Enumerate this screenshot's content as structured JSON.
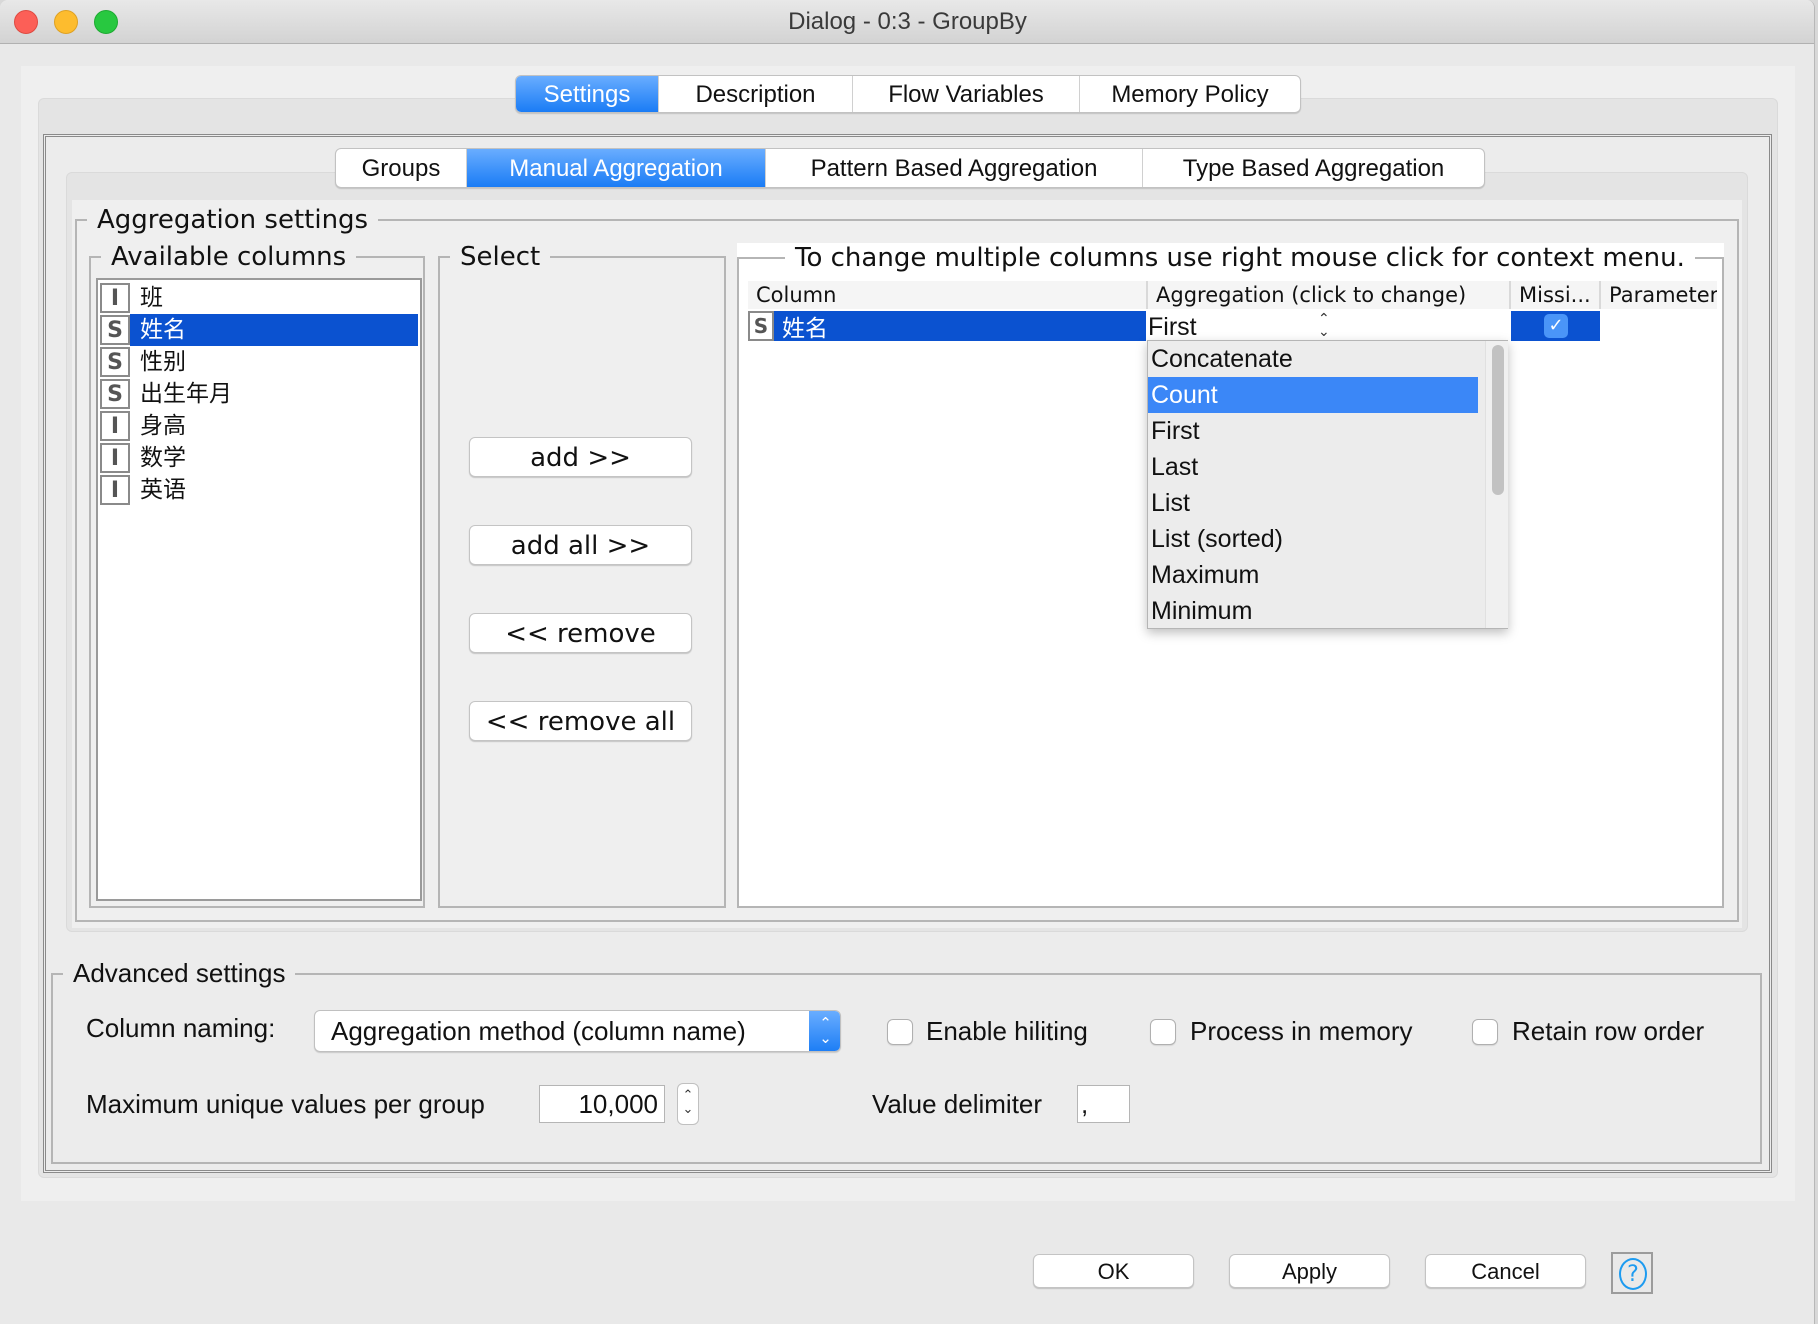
{
  "window": {
    "title": "Dialog - 0:3 - GroupBy",
    "traffic_lights": {
      "close": "#fc5f57",
      "minimize": "#fdbc2e",
      "zoom": "#28c840"
    }
  },
  "top_tabs": [
    {
      "label": "Settings",
      "active": true
    },
    {
      "label": "Description",
      "active": false
    },
    {
      "label": "Flow Variables",
      "active": false
    },
    {
      "label": "Memory Policy",
      "active": false
    }
  ],
  "sub_tabs": [
    {
      "label": "Groups",
      "active": false
    },
    {
      "label": "Manual Aggregation",
      "active": true
    },
    {
      "label": "Pattern Based Aggregation",
      "active": false
    },
    {
      "label": "Type Based Aggregation",
      "active": false
    }
  ],
  "aggregation_settings": {
    "title": "Aggregation settings",
    "available_columns": {
      "title": "Available columns",
      "items": [
        {
          "type": "I",
          "name": "班",
          "selected": false
        },
        {
          "type": "S",
          "name": "姓名",
          "selected": true
        },
        {
          "type": "S",
          "name": "性别",
          "selected": false
        },
        {
          "type": "S",
          "name": "出生年月",
          "selected": false
        },
        {
          "type": "I",
          "name": "身高",
          "selected": false
        },
        {
          "type": "I",
          "name": "数学",
          "selected": false
        },
        {
          "type": "I",
          "name": "英语",
          "selected": false
        }
      ]
    },
    "select": {
      "title": "Select",
      "buttons": [
        "add >>",
        "add all >>",
        "<< remove",
        "<< remove all"
      ]
    },
    "table": {
      "title": "To change multiple columns use right mouse click for context menu.",
      "headers": [
        "Column",
        "Aggregation (click to change)",
        "Missi...",
        "Parameter"
      ],
      "rows": [
        {
          "type": "S",
          "column": "姓名",
          "aggregation": "First",
          "missing": true,
          "parameter": ""
        }
      ],
      "dropdown": {
        "options": [
          "Concatenate",
          "Count",
          "First",
          "Last",
          "List",
          "List (sorted)",
          "Maximum",
          "Minimum"
        ],
        "highlighted": "Count"
      }
    }
  },
  "advanced_settings": {
    "title": "Advanced settings",
    "column_naming_label": "Column naming:",
    "column_naming_value": "Aggregation method (column name)",
    "enable_hiliting": {
      "label": "Enable hiliting",
      "checked": false
    },
    "process_in_memory": {
      "label": "Process in memory",
      "checked": false
    },
    "retain_row_order": {
      "label": "Retain row order",
      "checked": false
    },
    "max_unique_label": "Maximum unique values per group",
    "max_unique_value": "10,000",
    "value_delimiter_label": "Value delimiter",
    "value_delimiter_value": ","
  },
  "footer": {
    "ok": "OK",
    "apply": "Apply",
    "cancel": "Cancel",
    "help": "?"
  },
  "colors": {
    "accent": "#1a7cf5",
    "selection": "#0b52d0",
    "dropdown_highlight": "#3b87f7"
  }
}
